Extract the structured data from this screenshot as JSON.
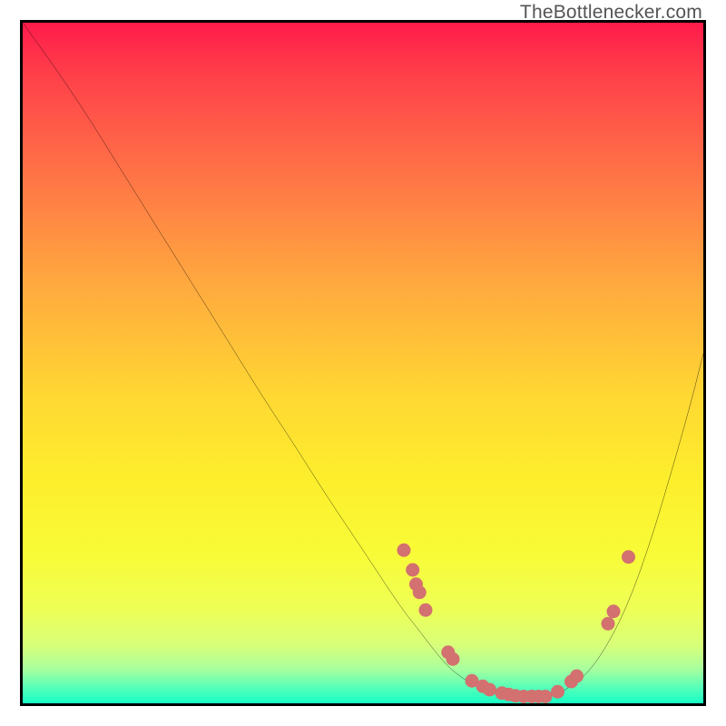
{
  "watermark": "TheBottlenecker.com",
  "chart_data": {
    "type": "line",
    "title": "",
    "xlabel": "",
    "ylabel": "",
    "xlim": [
      0,
      100
    ],
    "ylim": [
      0,
      100
    ],
    "legend": false,
    "grid": false,
    "background_gradient": {
      "direction": "vertical",
      "stops": [
        {
          "pos": 0,
          "color": "#ff1b4b"
        },
        {
          "pos": 8,
          "color": "#ff414a"
        },
        {
          "pos": 21,
          "color": "#ff6f47"
        },
        {
          "pos": 38,
          "color": "#ffa83f"
        },
        {
          "pos": 55,
          "color": "#ffd832"
        },
        {
          "pos": 67,
          "color": "#fdee2c"
        },
        {
          "pos": 78,
          "color": "#f8fb37"
        },
        {
          "pos": 86,
          "color": "#eeff55"
        },
        {
          "pos": 91.5,
          "color": "#d8ff7a"
        },
        {
          "pos": 95,
          "color": "#a7ff9e"
        },
        {
          "pos": 97.5,
          "color": "#5cffb7"
        },
        {
          "pos": 100,
          "color": "#17ffc6"
        }
      ]
    },
    "series": [
      {
        "name": "bottleneck-curve",
        "color": "#000000",
        "x": [
          0,
          5,
          10,
          15,
          20,
          25,
          30,
          35,
          40,
          45,
          50,
          55,
          58,
          62,
          65,
          68,
          72,
          75,
          78,
          80,
          83,
          86,
          89,
          92,
          95,
          98,
          100
        ],
        "y": [
          100,
          93,
          85.5,
          77.5,
          69.5,
          61.5,
          53.5,
          45.5,
          37.8,
          30,
          22.5,
          15,
          11,
          6,
          3.5,
          2,
          1,
          0.8,
          1.2,
          2.2,
          4.6,
          8.9,
          15.0,
          23.2,
          33.0,
          43.6,
          51.4
        ]
      }
    ],
    "points": [
      {
        "x": 56.0,
        "y": 22.5
      },
      {
        "x": 57.3,
        "y": 19.6
      },
      {
        "x": 57.8,
        "y": 17.5
      },
      {
        "x": 58.3,
        "y": 16.3
      },
      {
        "x": 59.2,
        "y": 13.7
      },
      {
        "x": 62.5,
        "y": 7.5
      },
      {
        "x": 63.2,
        "y": 6.5
      },
      {
        "x": 66.0,
        "y": 3.3
      },
      {
        "x": 67.6,
        "y": 2.5
      },
      {
        "x": 68.6,
        "y": 2.0
      },
      {
        "x": 70.4,
        "y": 1.5
      },
      {
        "x": 71.4,
        "y": 1.3
      },
      {
        "x": 72.4,
        "y": 1.1
      },
      {
        "x": 73.6,
        "y": 1.0
      },
      {
        "x": 74.8,
        "y": 1.0
      },
      {
        "x": 75.8,
        "y": 1.0
      },
      {
        "x": 76.8,
        "y": 1.0
      },
      {
        "x": 78.6,
        "y": 1.7
      },
      {
        "x": 80.6,
        "y": 3.2
      },
      {
        "x": 81.4,
        "y": 4.0
      },
      {
        "x": 86.0,
        "y": 11.7
      },
      {
        "x": 86.8,
        "y": 13.5
      },
      {
        "x": 89.0,
        "y": 21.5
      }
    ],
    "point_style": {
      "color": "#d37070",
      "radius_pct": 1.0
    }
  }
}
